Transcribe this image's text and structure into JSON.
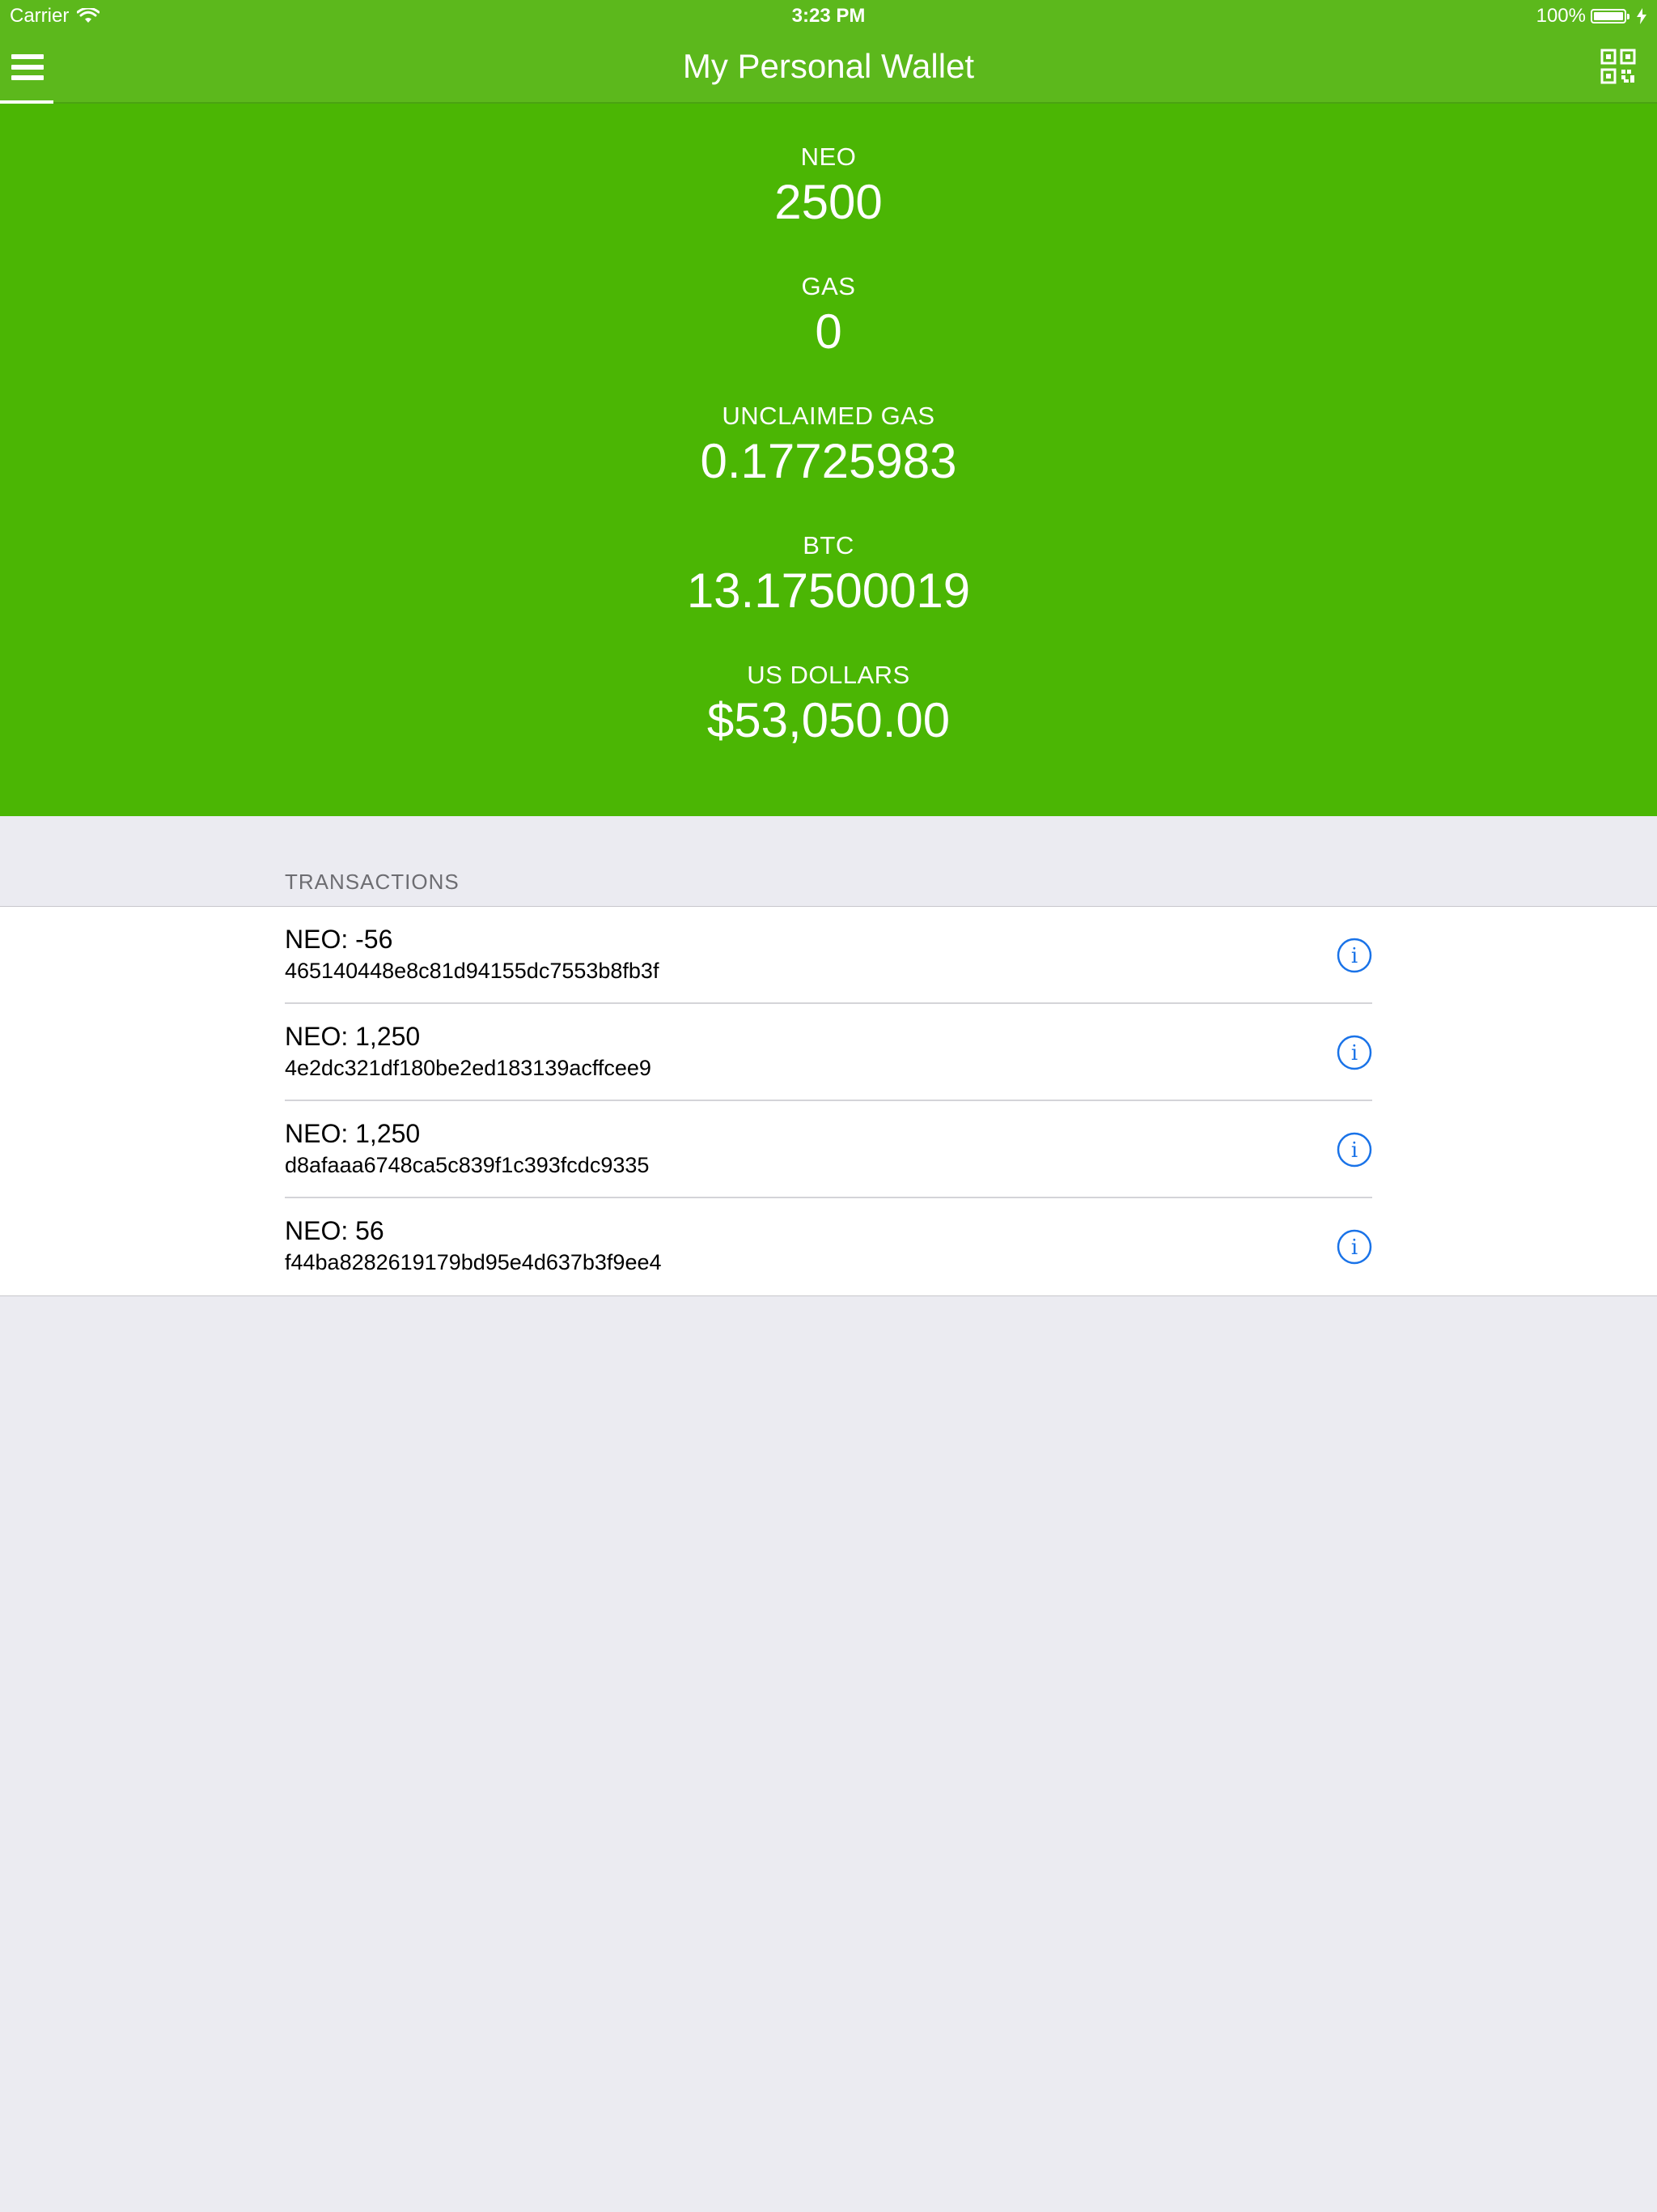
{
  "status_bar": {
    "carrier": "Carrier",
    "time": "3:23 PM",
    "battery": "100%",
    "battery_level": 1.0
  },
  "nav": {
    "title": "My Personal Wallet",
    "menu_icon": "hamburger-menu-icon",
    "qr_icon": "qr-code-icon"
  },
  "balances": [
    {
      "label": "NEO",
      "value": "2500"
    },
    {
      "label": "GAS",
      "value": "0"
    },
    {
      "label": "UNCLAIMED GAS",
      "value": "0.17725983"
    },
    {
      "label": "BTC",
      "value": "13.17500019"
    },
    {
      "label": "US DOLLARS",
      "value": "$53,050.00"
    }
  ],
  "transactions": {
    "header": "TRANSACTIONS",
    "items": [
      {
        "amount": "NEO: -56",
        "hash": "465140448e8c81d94155dc7553b8fb3f"
      },
      {
        "amount": "NEO: 1,250",
        "hash": "4e2dc321df180be2ed183139acffcee9"
      },
      {
        "amount": "NEO: 1,250",
        "hash": "d8afaaa6748ca5c839f1c393fcdc9335"
      },
      {
        "amount": "NEO: 56",
        "hash": "f44ba8282619179bd95e4d637b3f9ee4"
      }
    ]
  },
  "colors": {
    "nav_green": "#5cb81c",
    "panel_green": "#4bb604",
    "background": "#ebebf1",
    "info_blue": "#1a73e8"
  }
}
